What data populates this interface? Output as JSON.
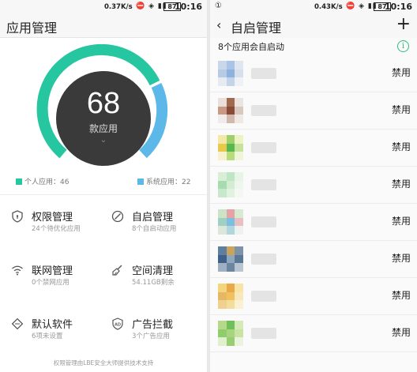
{
  "left": {
    "status": {
      "speed": "0.37K/s",
      "icons": "⛔ ◈ ▮▮",
      "battery": "87",
      "time": "10:16"
    },
    "title": "应用管理",
    "gauge": {
      "count": "68",
      "label": "款应用",
      "chevron": "⌄"
    },
    "legend": {
      "personal": {
        "label": "个人应用：46",
        "color": "#26c6a0"
      },
      "system": {
        "label": "系统应用：22",
        "color": "#5db8ea"
      }
    },
    "grid": [
      {
        "title": "权限管理",
        "sub": "24个待优化应用",
        "icon": "shield-icon"
      },
      {
        "title": "自启管理",
        "sub": "8个自启动应用",
        "icon": "slash-circle-icon"
      },
      {
        "title": "联网管理",
        "sub": "0个禁网应用",
        "icon": "wifi-icon"
      },
      {
        "title": "空间清理",
        "sub": "54.11GB剩余",
        "icon": "broom-icon"
      },
      {
        "title": "默认软件",
        "sub": "6项未设置",
        "icon": "diamond-icon"
      },
      {
        "title": "广告拦截",
        "sub": "3个广告应用",
        "icon": "ad-shield-icon"
      }
    ],
    "footer": "权限管理由LBE安全大师提供技术支持"
  },
  "right": {
    "status": {
      "indicator": "①",
      "speed": "0.43K/s",
      "icons": "⛔ ◈ ▮▮",
      "battery": "87",
      "time": "10:16"
    },
    "back": "‹",
    "title": "自启管理",
    "add": "+",
    "subtitle": "8个应用会自启动",
    "info": "i",
    "disable_label": "禁用",
    "apps": [
      {
        "colors": [
          "#c9d7ea",
          "#a9c4e6",
          "#dfe6ef",
          "#b7cbe6",
          "#8eb2df",
          "#d6e0ec",
          "#e6ebf1",
          "#c4d4e8",
          "#eef1f5"
        ]
      },
      {
        "colors": [
          "#e9e0dc",
          "#a06a4e",
          "#ece4e0",
          "#c89a86",
          "#8b4a35",
          "#d9c8c0",
          "#f0eceb",
          "#d2b9ad",
          "#efe9e6"
        ]
      },
      {
        "colors": [
          "#f4e8a8",
          "#9fd06a",
          "#eef3c6",
          "#e8c94b",
          "#56b84e",
          "#c5e39a",
          "#f7f1cf",
          "#b8dc7a",
          "#eef5d9"
        ]
      },
      {
        "colors": [
          "#d8efd6",
          "#bfe6c2",
          "#e7f4e6",
          "#a6dcb0",
          "#d4ecd1",
          "#eef7ee",
          "#c8e8cb",
          "#e2f2e1",
          "#f3f9f2"
        ]
      },
      {
        "colors": [
          "#cbe3c6",
          "#e7a3a3",
          "#d8ead2",
          "#9fd0c2",
          "#7cbfe1",
          "#e9c0c0",
          "#dbe7d8",
          "#b2d6e0",
          "#eef2ee"
        ]
      },
      {
        "colors": [
          "#5f7f9e",
          "#c9a45a",
          "#7d93aa",
          "#3f6189",
          "#8fa7bd",
          "#5a7896",
          "#9eb0c2",
          "#6c86a1",
          "#b9c6d2"
        ]
      },
      {
        "colors": [
          "#f3d67c",
          "#e9a94a",
          "#f7e4a6",
          "#e6b865",
          "#f0c25f",
          "#f8e9bd",
          "#efd08e",
          "#f4dd9c",
          "#faf0d2"
        ]
      },
      {
        "colors": [
          "#b5d88a",
          "#6fbf5b",
          "#d6e9b8",
          "#8fcc6a",
          "#a8d47f",
          "#c9e3a3",
          "#e0efcc",
          "#99cd73",
          "#eaf4dd"
        ]
      }
    ]
  }
}
